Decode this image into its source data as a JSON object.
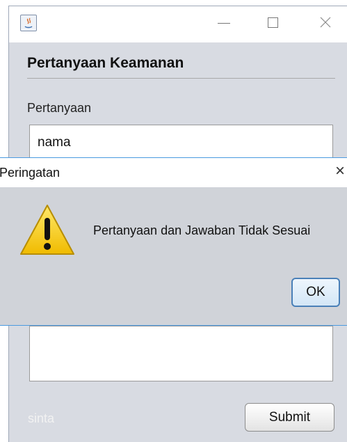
{
  "window": {
    "title_icon": "java-icon",
    "controls": [
      "minimize",
      "maximize",
      "close"
    ]
  },
  "form": {
    "section_title": "Pertanyaan Keamanan",
    "question_label": "Pertanyaan",
    "question_value": "nama",
    "answer_value": "",
    "user_label": "sinta",
    "submit_label": "Submit"
  },
  "dialog": {
    "title": "Peringatan",
    "message": "Pertanyaan dan Jawaban Tidak Sesuai",
    "ok_label": "OK",
    "icon": "warning-icon",
    "close_glyph": "×"
  },
  "colors": {
    "accent": "#4a9ae0",
    "warning": "#f2c400"
  }
}
